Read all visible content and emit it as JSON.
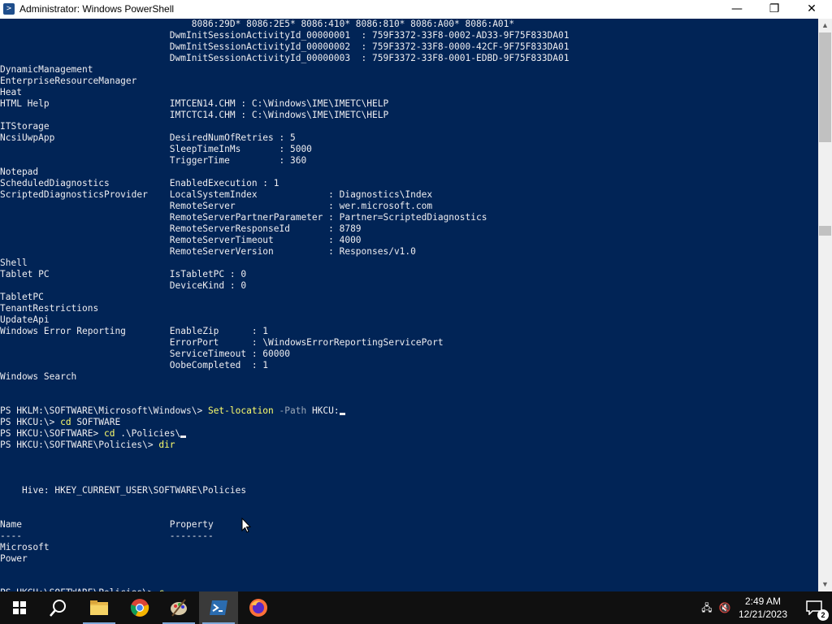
{
  "window": {
    "title": "Administrator: Windows PowerShell",
    "icon_glyph": ">",
    "minimize_glyph": "—",
    "maximize_glyph": "❐",
    "close_glyph": "✕"
  },
  "console": {
    "colors": {
      "background": "#012456",
      "text": "#eeedf0",
      "command": "#fdfd6c",
      "parameter": "#9aa7b8"
    },
    "lines": [
      "                                   8086:29D* 8086:2E5* 8086:410* 8086:810* 8086:A00* 8086:A01*",
      "                               DwmInitSessionActivityId_00000001  : 759F3372-33F8-0002-AD33-9F75F833DA01",
      "                               DwmInitSessionActivityId_00000002  : 759F3372-33F8-0000-42CF-9F75F833DA01",
      "                               DwmInitSessionActivityId_00000003  : 759F3372-33F8-0001-EDBD-9F75F833DA01",
      "DynamicManagement",
      "EnterpriseResourceManager",
      "Heat",
      "HTML Help                      IMTCEN14.CHM : C:\\Windows\\IME\\IMETC\\HELP",
      "                               IMTCTC14.CHM : C:\\Windows\\IME\\IMETC\\HELP",
      "ITStorage",
      "NcsiUwpApp                     DesiredNumOfRetries : 5",
      "                               SleepTimeInMs       : 5000",
      "                               TriggerTime         : 360",
      "Notepad",
      "ScheduledDiagnostics           EnabledExecution : 1",
      "ScriptedDiagnosticsProvider    LocalSystemIndex             : Diagnostics\\Index",
      "                               RemoteServer                 : wer.microsoft.com",
      "                               RemoteServerPartnerParameter : Partner=ScriptedDiagnostics",
      "                               RemoteServerResponseId       : 8789",
      "                               RemoteServerTimeout          : 4000",
      "                               RemoteServerVersion          : Responses/v1.0",
      "Shell",
      "Tablet PC                      IsTabletPC : 0",
      "                               DeviceKind : 0",
      "TabletPC",
      "TenantRestrictions",
      "UpdateApi",
      "Windows Error Reporting        EnableZip      : 1",
      "                               ErrorPort      : \\WindowsErrorReportingServicePort",
      "                               ServiceTimeout : 60000",
      "                               OobeCompleted  : 1",
      "Windows Search",
      "",
      "",
      "",
      "",
      "",
      "",
      "",
      "",
      "",
      "",
      "",
      "",
      "    Hive: HKEY_CURRENT_USER\\SOFTWARE\\Policies",
      "",
      "",
      "Name                           Property",
      "----                           --------",
      "Microsoft",
      "Power",
      "",
      "",
      ""
    ],
    "prompt_lines": {
      "line1_prompt": "PS HKLM:\\SOFTWARE\\Microsoft\\Windows\\> ",
      "line1_cmd": "Set-location",
      "line1_param": " -Path",
      "line1_arg": " HKCU:",
      "line2_prompt": "PS HKCU:\\> ",
      "line2_cmd": "cd",
      "line2_arg": " SOFTWARE",
      "line3_prompt": "PS HKCU:\\SOFTWARE> ",
      "line3_cmd": "cd",
      "line3_arg": " .\\Policies\\",
      "line4_prompt": "PS HKCU:\\SOFTWARE\\Policies\\> ",
      "line4_cmd": "dir",
      "last_prompt": "PS HKCU:\\SOFTWARE\\Policies\\> ",
      "last_input": "c"
    }
  },
  "taskbar": {
    "apps": [
      {
        "name": "start",
        "icon": "windows-logo-icon"
      },
      {
        "name": "search",
        "icon": "search-icon"
      },
      {
        "name": "file-explorer",
        "icon": "folder-icon"
      },
      {
        "name": "chrome",
        "icon": "chrome-icon"
      },
      {
        "name": "paint",
        "icon": "paint-palette-icon"
      },
      {
        "name": "powershell",
        "icon": "powershell-icon",
        "active": true
      },
      {
        "name": "firefox",
        "icon": "firefox-icon"
      }
    ],
    "clock": {
      "time": "2:49 AM",
      "date": "12/21/2023"
    },
    "notification_count": "2"
  }
}
